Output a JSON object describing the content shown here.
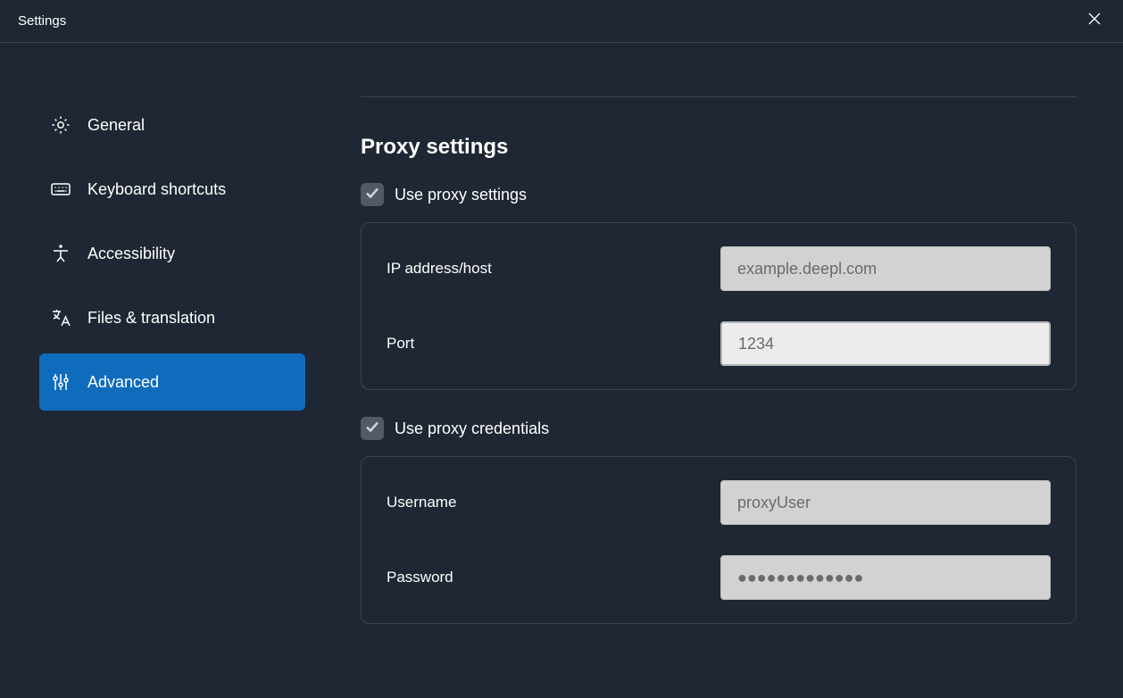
{
  "titlebar": {
    "title": "Settings"
  },
  "sidebar": {
    "items": [
      {
        "label": "General",
        "icon": "gear-icon",
        "active": false
      },
      {
        "label": "Keyboard shortcuts",
        "icon": "keyboard-icon",
        "active": false
      },
      {
        "label": "Accessibility",
        "icon": "accessibility-icon",
        "active": false
      },
      {
        "label": "Files & translation",
        "icon": "translate-icon",
        "active": false
      },
      {
        "label": "Advanced",
        "icon": "sliders-icon",
        "active": true
      }
    ]
  },
  "main": {
    "section_title": "Proxy settings",
    "use_proxy_settings": {
      "label": "Use proxy settings",
      "checked": true
    },
    "use_proxy_credentials": {
      "label": "Use proxy credentials",
      "checked": true
    },
    "fields": {
      "ip_host": {
        "label": "IP address/host",
        "placeholder": "example.deepl.com",
        "value": ""
      },
      "port": {
        "label": "Port",
        "placeholder": "1234",
        "value": ""
      },
      "username": {
        "label": "Username",
        "placeholder": "proxyUser",
        "value": ""
      },
      "password": {
        "label": "Password",
        "placeholder": "●●●●●●●●●●●●●",
        "value": ""
      }
    }
  }
}
